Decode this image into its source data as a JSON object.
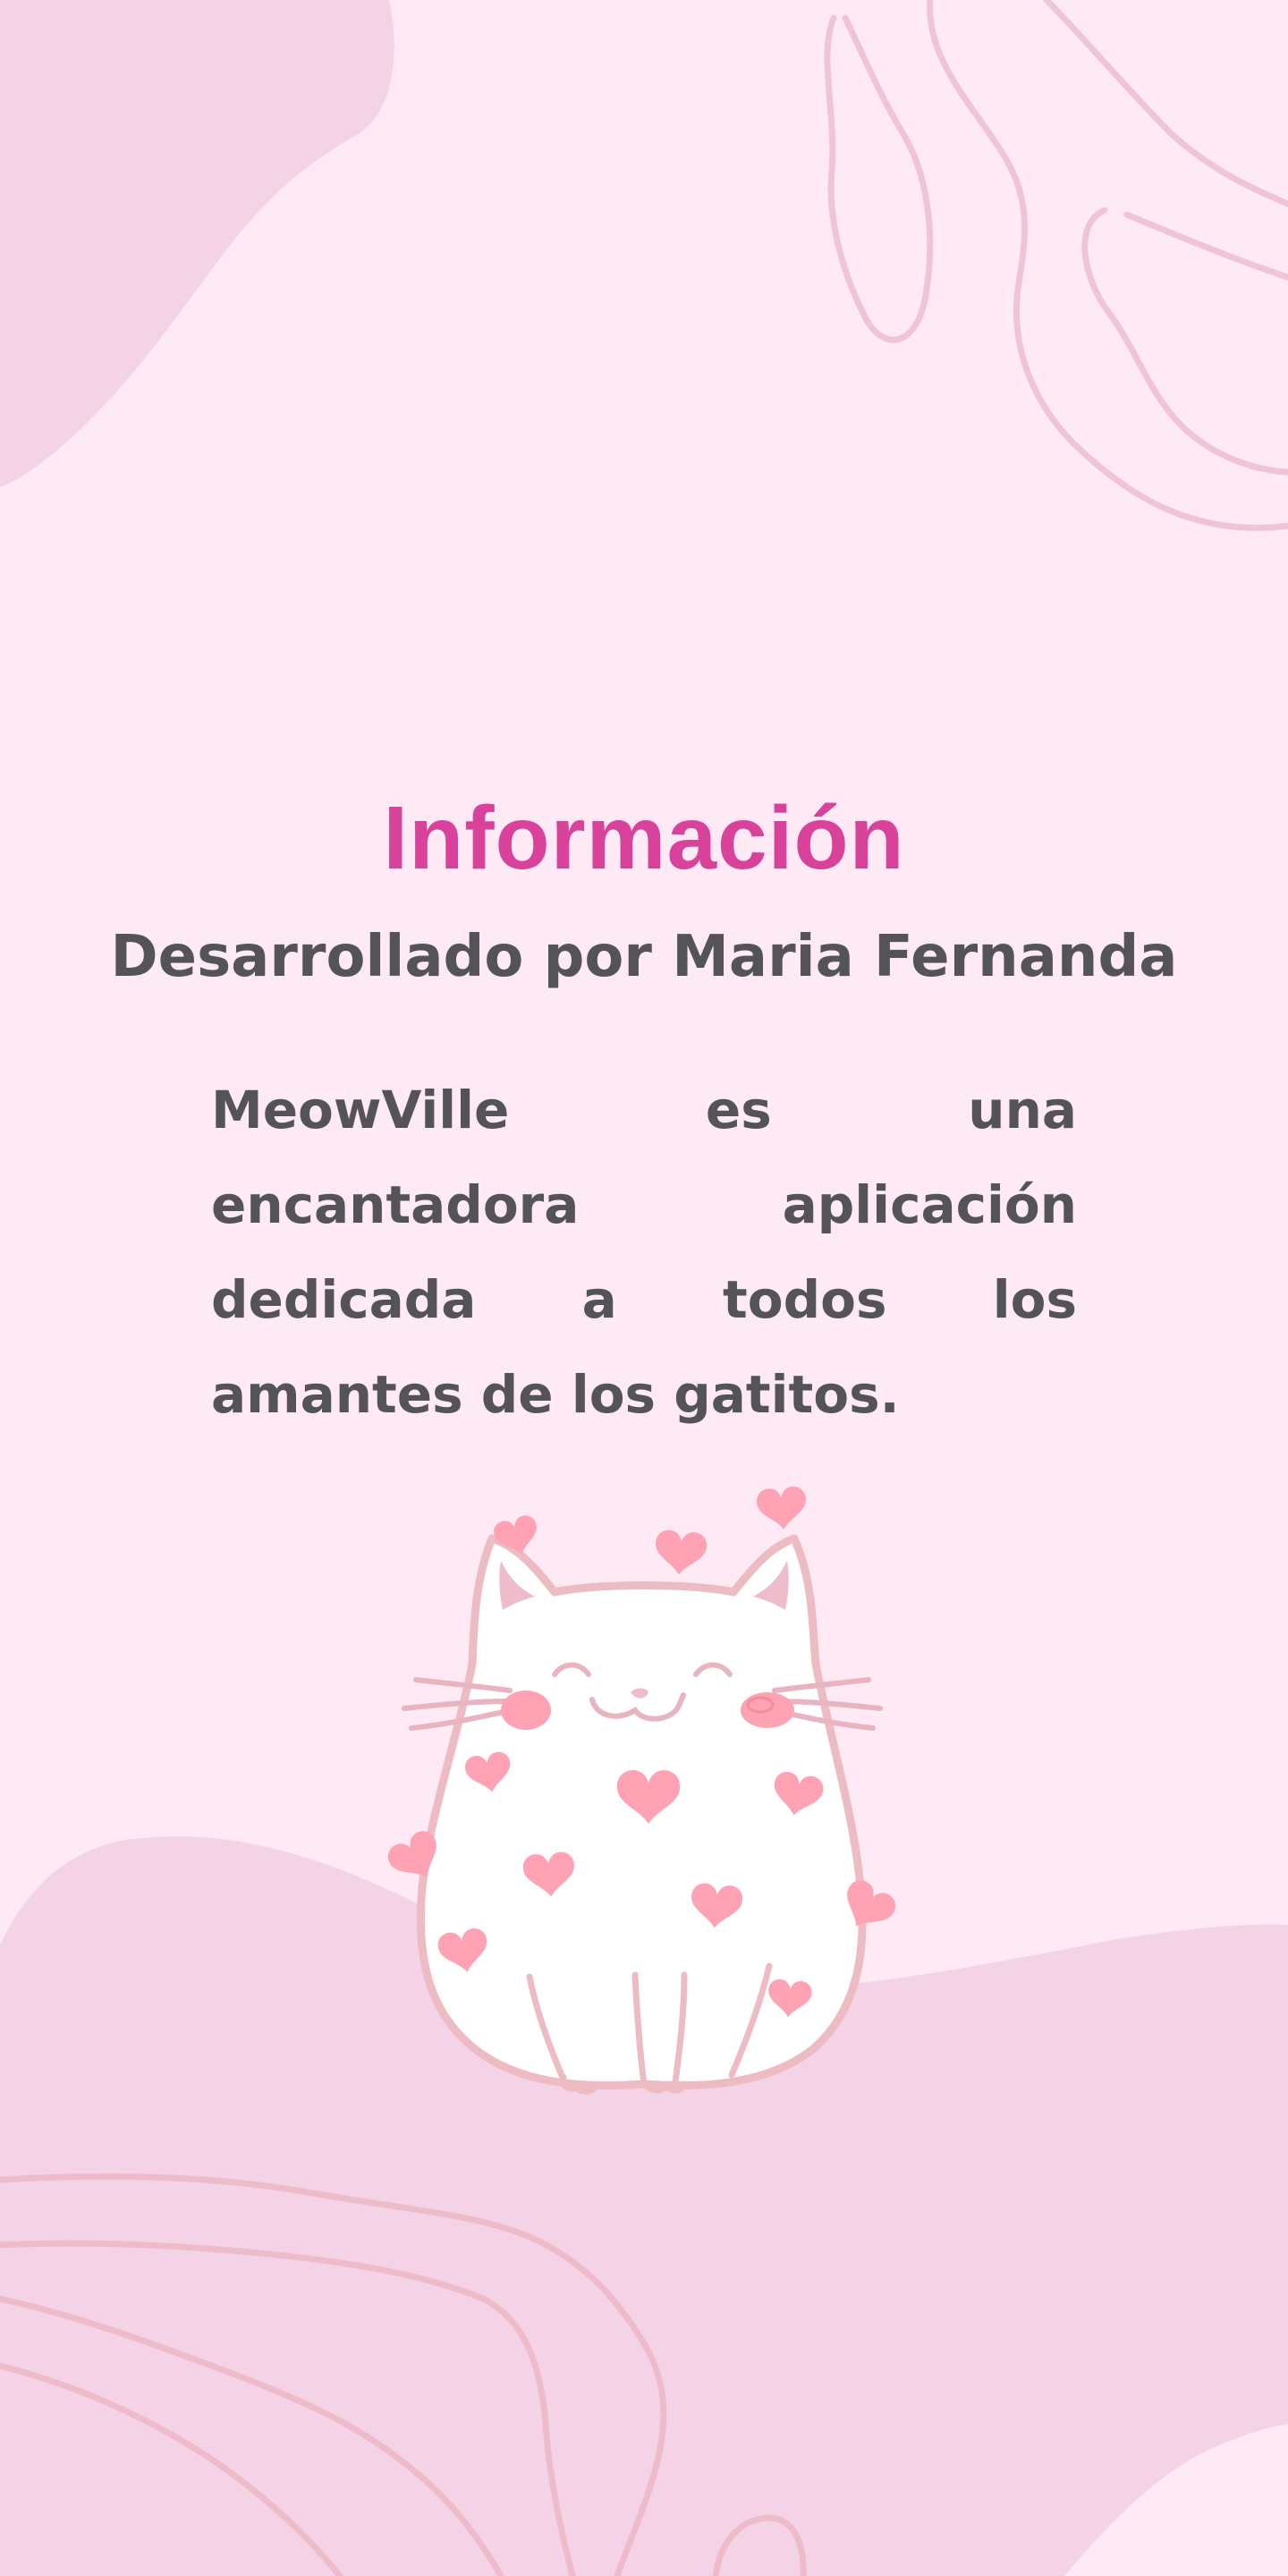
{
  "page": {
    "title": "Información",
    "subtitle": "Desarrollado por Maria Fernanda",
    "description": "MeowVille es una encantadora aplicación dedicada a todos los amantes de los gatitos."
  },
  "illustration": {
    "icon": "kitten-with-hearts-icon"
  },
  "colors": {
    "background": "#fdeaf5",
    "blob": "#f5d3e6",
    "line_art": "#eebccb",
    "accent_title": "#d9429b",
    "text": "#545355",
    "heart": "#ffa2b4"
  }
}
